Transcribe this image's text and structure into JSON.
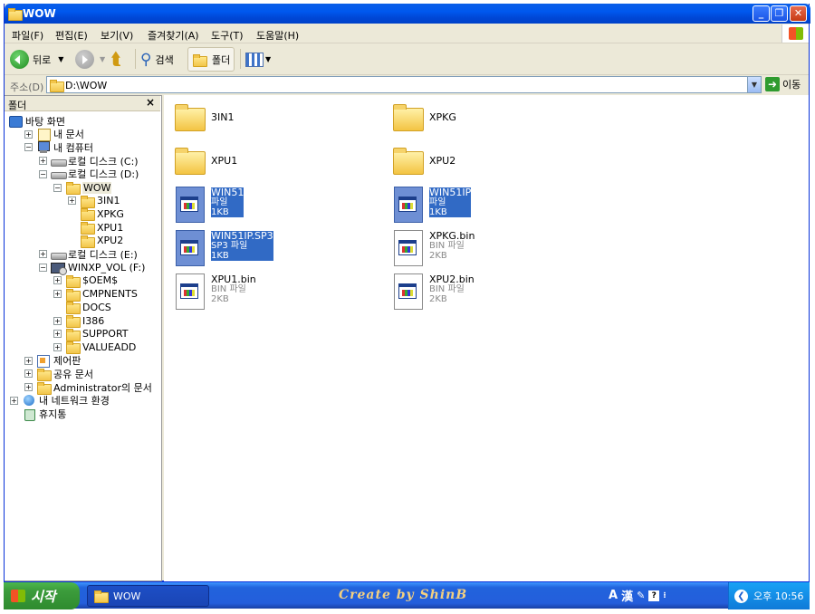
{
  "window": {
    "title": "WOW"
  },
  "menu": [
    "파일(F)",
    "편집(E)",
    "보기(V)",
    "즐겨찾기(A)",
    "도구(T)",
    "도움말(H)"
  ],
  "toolbar": {
    "back": "뒤로",
    "search": "검색",
    "folders": "폴더"
  },
  "address": {
    "label": "주소(D)",
    "value": "D:\\WOW",
    "go": "이동"
  },
  "folders_pane": {
    "title": "폴더",
    "close": "×",
    "tree": [
      {
        "label": "바탕 화면",
        "icon": "desktop-icon",
        "expander": ""
      },
      {
        "label": "내 문서",
        "icon": "documents-icon",
        "expander": "+"
      },
      {
        "label": "내 컴퓨터",
        "icon": "computer-icon",
        "expander": "−"
      },
      {
        "label": "로컬 디스크 (C:)",
        "icon": "drive-icon",
        "expander": "+"
      },
      {
        "label": "로컬 디스크 (D:)",
        "icon": "drive-icon",
        "expander": "−"
      },
      {
        "label": "WOW",
        "icon": "folder-icon",
        "expander": "−"
      },
      {
        "label": "3IN1",
        "icon": "folder-icon",
        "expander": "+"
      },
      {
        "label": "XPKG",
        "icon": "folder-icon",
        "expander": ""
      },
      {
        "label": "XPU1",
        "icon": "folder-icon",
        "expander": ""
      },
      {
        "label": "XPU2",
        "icon": "folder-icon",
        "expander": ""
      },
      {
        "label": "로컬 디스크 (E:)",
        "icon": "drive-icon",
        "expander": "+"
      },
      {
        "label": "WINXP_VOL (F:)",
        "icon": "cd-drive-icon",
        "expander": "−"
      },
      {
        "label": "$OEM$",
        "icon": "folder-icon",
        "expander": "+"
      },
      {
        "label": "CMPNENTS",
        "icon": "folder-icon",
        "expander": "+"
      },
      {
        "label": "DOCS",
        "icon": "folder-icon",
        "expander": ""
      },
      {
        "label": "I386",
        "icon": "folder-icon",
        "expander": "+"
      },
      {
        "label": "SUPPORT",
        "icon": "folder-icon",
        "expander": "+"
      },
      {
        "label": "VALUEADD",
        "icon": "folder-icon",
        "expander": "+"
      },
      {
        "label": "제어판",
        "icon": "control-panel-icon",
        "expander": "+"
      },
      {
        "label": "공유 문서",
        "icon": "folder-icon",
        "expander": "+"
      },
      {
        "label": "Administrator의 문서",
        "icon": "folder-icon",
        "expander": "+"
      },
      {
        "label": "내 네트워크 환경",
        "icon": "network-icon",
        "expander": "+"
      },
      {
        "label": "휴지통",
        "icon": "recycle-bin-icon",
        "expander": ""
      }
    ]
  },
  "files": [
    {
      "name": "3IN1",
      "type": "folder"
    },
    {
      "name": "XPKG",
      "type": "folder"
    },
    {
      "name": "XPU1",
      "type": "folder"
    },
    {
      "name": "XPU2",
      "type": "folder"
    },
    {
      "name": "WIN51",
      "kind": "파일",
      "size": "1KB",
      "type": "file",
      "selected": true
    },
    {
      "name": "WIN51IP",
      "kind": "파일",
      "size": "1KB",
      "type": "file",
      "selected": true
    },
    {
      "name": "WIN51IP.SP3",
      "kind": "SP3 파일",
      "size": "1KB",
      "type": "file",
      "selected": true
    },
    {
      "name": "XPKG.bin",
      "kind": "BIN 파일",
      "size": "2KB",
      "type": "file",
      "selected": false
    },
    {
      "name": "XPU1.bin",
      "kind": "BIN 파일",
      "size": "2KB",
      "type": "file",
      "selected": false
    },
    {
      "name": "XPU2.bin",
      "kind": "BIN 파일",
      "size": "2KB",
      "type": "file",
      "selected": false
    }
  ],
  "taskbar": {
    "start": "시작",
    "task": "WOW",
    "signature": "Create by ShinB",
    "ime": [
      "A",
      "漢"
    ],
    "clock": "오후 10:56"
  },
  "colors": {
    "selection": "#316ac5",
    "titlebar": "#0058ee",
    "start": "#3c9c3c"
  }
}
